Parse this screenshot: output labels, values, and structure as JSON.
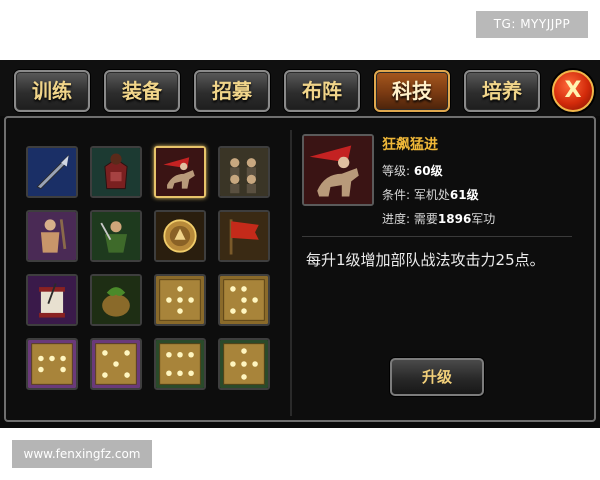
{
  "watermarks": {
    "top": "TG: MYYJJPP",
    "bottom": "www.fenxingfz.com"
  },
  "tabs": [
    {
      "label": "训练",
      "active": false
    },
    {
      "label": "装备",
      "active": false
    },
    {
      "label": "招募",
      "active": false
    },
    {
      "label": "布阵",
      "active": false
    },
    {
      "label": "科技",
      "active": true
    },
    {
      "label": "培养",
      "active": false
    }
  ],
  "close_label": "X",
  "tech_grid": [
    {
      "icon": "spear-icon",
      "selected": false
    },
    {
      "icon": "armor-icon",
      "selected": false
    },
    {
      "icon": "cavalry-charge-icon",
      "selected": true
    },
    {
      "icon": "soldiers-group-icon",
      "selected": false
    },
    {
      "icon": "warrior-icon",
      "selected": false
    },
    {
      "icon": "general-icon",
      "selected": false
    },
    {
      "icon": "emblem-icon",
      "selected": false
    },
    {
      "icon": "war-banner-icon",
      "selected": false
    },
    {
      "icon": "scroll-icon",
      "selected": false
    },
    {
      "icon": "supply-bag-icon",
      "selected": false
    },
    {
      "icon": "formation-plus-icon",
      "selected": false
    },
    {
      "icon": "formation-snake-icon",
      "selected": false
    },
    {
      "icon": "formation-dots-a-icon",
      "selected": false
    },
    {
      "icon": "formation-dots-b-icon",
      "selected": false
    },
    {
      "icon": "formation-dots-c-icon",
      "selected": false
    },
    {
      "icon": "formation-dots-d-icon",
      "selected": false
    }
  ],
  "detail": {
    "name": "狂飙猛进",
    "level_label": "等级:",
    "level_value": "60级",
    "condition_label": "条件:",
    "condition_prefix": "军机处",
    "condition_value": "61级",
    "progress_label": "进度:",
    "progress_prefix": "需要",
    "progress_value": "1896",
    "progress_suffix": "军功",
    "description": "每升1级增加部队战法攻击力25点。",
    "upgrade_label": "升级"
  },
  "colors": {
    "accent_gold": "#f0b838",
    "active_tab": "#a5581e",
    "close_red": "#d22a0a"
  }
}
